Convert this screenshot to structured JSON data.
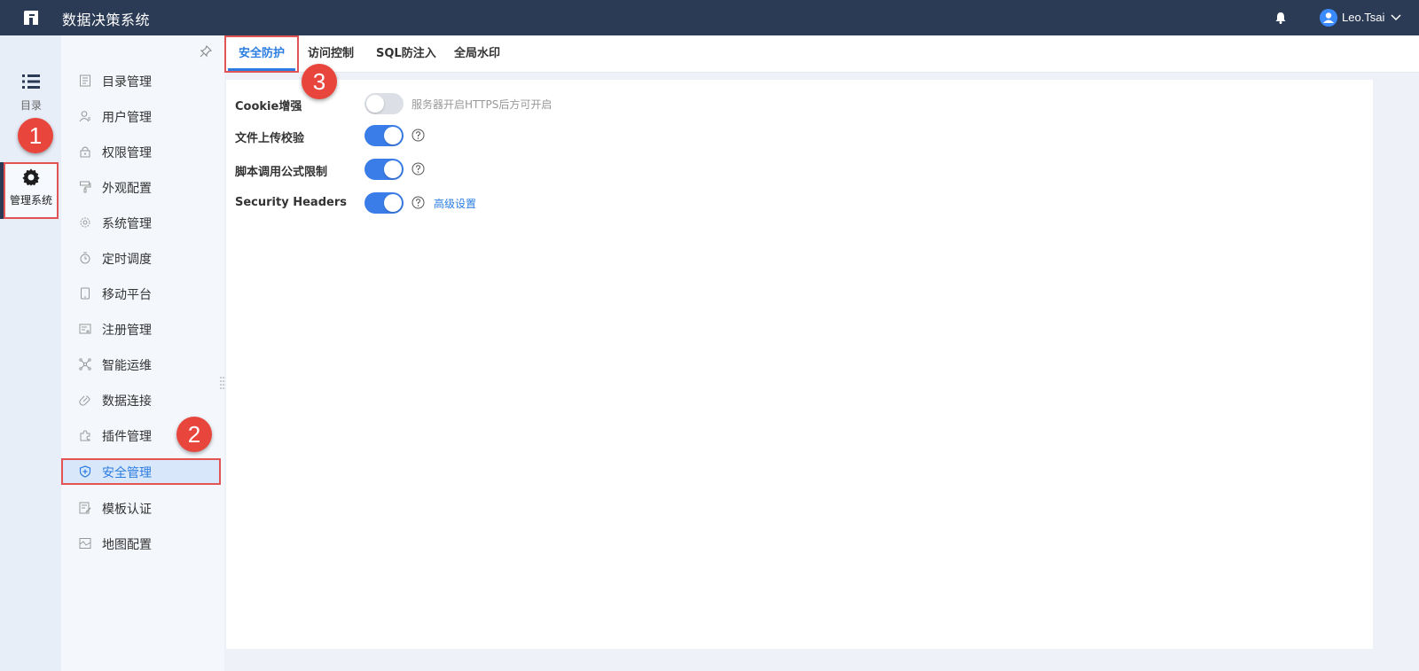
{
  "app": {
    "title": "数据决策系统",
    "logo_icon": "fanruan-logo-icon"
  },
  "header": {
    "notification_icon": "bell-icon",
    "user_name": "Leo.Tsai",
    "user_icon": "user-avatar-icon"
  },
  "rail": {
    "items": [
      {
        "label": "目录",
        "icon": "list-icon"
      },
      {
        "label": "管理系统",
        "icon": "gear-icon",
        "selected": true
      }
    ]
  },
  "sidebar": {
    "items": [
      {
        "label": "目录管理",
        "icon": "directory-icon"
      },
      {
        "label": "用户管理",
        "icon": "user-icon"
      },
      {
        "label": "权限管理",
        "icon": "lock-icon"
      },
      {
        "label": "外观配置",
        "icon": "paint-roller-icon"
      },
      {
        "label": "系统管理",
        "icon": "gear-icon"
      },
      {
        "label": "定时调度",
        "icon": "timer-icon"
      },
      {
        "label": "移动平台",
        "icon": "tablet-icon"
      },
      {
        "label": "注册管理",
        "icon": "register-icon"
      },
      {
        "label": "智能运维",
        "icon": "network-icon"
      },
      {
        "label": "数据连接",
        "icon": "link-icon"
      },
      {
        "label": "插件管理",
        "icon": "puzzle-icon"
      },
      {
        "label": "安全管理",
        "icon": "shield-icon",
        "selected": true
      },
      {
        "label": "模板认证",
        "icon": "template-icon"
      },
      {
        "label": "地图配置",
        "icon": "map-icon"
      }
    ]
  },
  "tabs": [
    {
      "label": "安全防护",
      "selected": true
    },
    {
      "label": "访问控制"
    },
    {
      "label": "SQL防注入"
    },
    {
      "label": "全局水印"
    }
  ],
  "settings": [
    {
      "label": "Cookie增强",
      "enabled": false,
      "hint": "服务器开启HTTPS后方可开启"
    },
    {
      "label": "文件上传校验",
      "enabled": true,
      "help_icon": "question-circle-icon"
    },
    {
      "label": "脚本调用公式限制",
      "enabled": true,
      "help_icon": "question-circle-icon"
    },
    {
      "label": "Security Headers",
      "enabled": true,
      "help_icon": "question-circle-icon",
      "link": "高级设置"
    }
  ],
  "markers": [
    "1",
    "2",
    "3"
  ],
  "colors": {
    "header_bg": "#2b3a55",
    "accent": "#2b7de1",
    "toggle_on": "#3a7de8",
    "highlight_border": "#e25454",
    "marker": "#e8453c"
  }
}
